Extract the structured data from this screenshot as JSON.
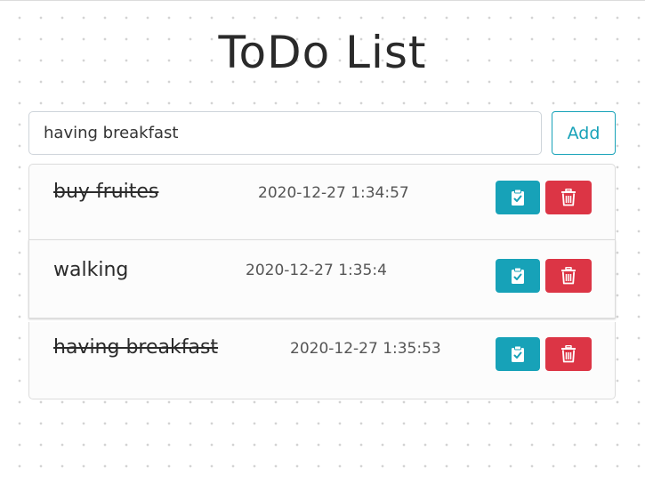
{
  "app": {
    "title": "ToDo List"
  },
  "input": {
    "value": "having breakfast",
    "add_label": "Add"
  },
  "todos": [
    {
      "text": "buy fruites",
      "time": "2020-12-27 1:34:57",
      "completed": true
    },
    {
      "text": "walking",
      "time": "2020-12-27 1:35:4",
      "completed": false
    },
    {
      "text": "having breakfast",
      "time": "2020-12-27 1:35:53",
      "completed": true
    }
  ],
  "icons": {
    "check": "clipboard-check-icon",
    "delete": "trash-icon"
  },
  "colors": {
    "accent": "#17a2b8",
    "danger": "#dc3545"
  }
}
